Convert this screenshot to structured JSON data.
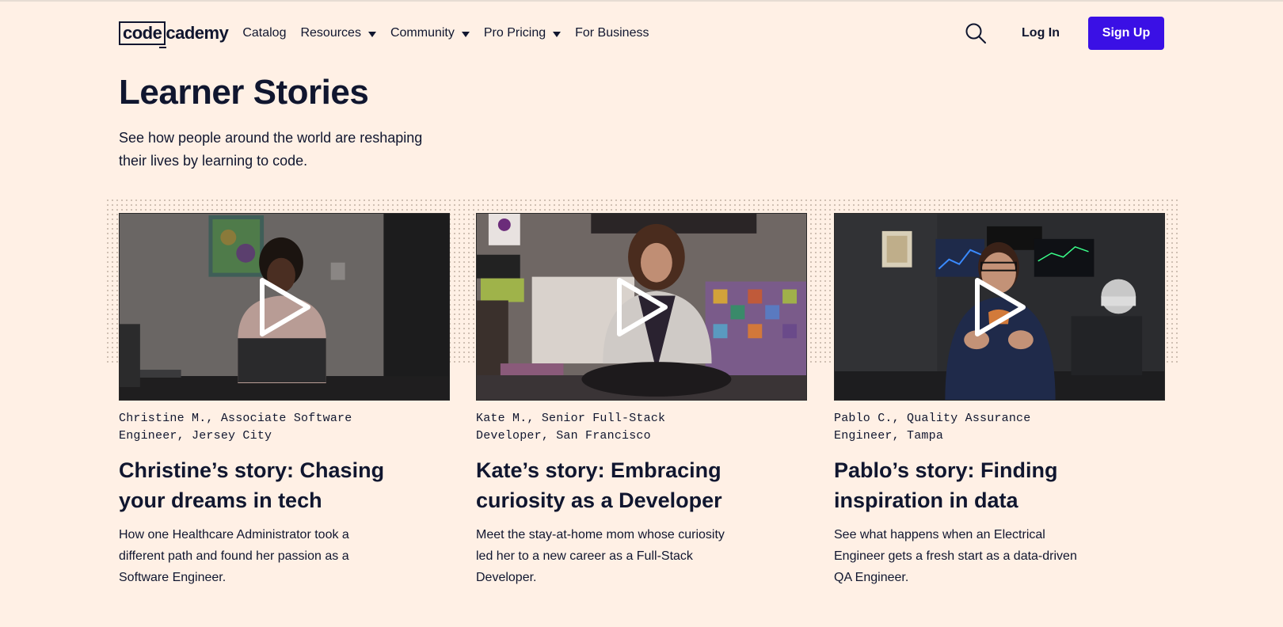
{
  "header": {
    "logo": {
      "boxed": "code",
      "rest": "cademy"
    },
    "nav": [
      {
        "label": "Catalog",
        "has_caret": false
      },
      {
        "label": "Resources",
        "has_caret": true
      },
      {
        "label": "Community",
        "has_caret": true
      },
      {
        "label": "Pro Pricing",
        "has_caret": true
      },
      {
        "label": "For Business",
        "has_caret": false
      }
    ],
    "search_icon": "search-icon",
    "login_label": "Log In",
    "signup_label": "Sign Up"
  },
  "hero": {
    "title": "Learner Stories",
    "subtitle": "See how people around the world are reshaping their lives by learning to code."
  },
  "stories": [
    {
      "byline": "Christine M., Associate Software Engineer, Jersey City",
      "title": "Christine’s story: Chasing your dreams in tech",
      "description": "How one Healthcare Administrator took a different path and found her passion as a Software Engineer."
    },
    {
      "byline": "Kate M., Senior Full-Stack Developer, San Francisco",
      "title": "Kate’s story: Embracing curiosity as a Developer",
      "description": "Meet the stay-at-home mom whose curiosity led her to a new career as a Full-Stack Developer."
    },
    {
      "byline": "Pablo C., Quality Assurance Engineer, Tampa",
      "title": "Pablo’s story: Finding inspiration in data",
      "description": "See what happens when an Electrical Engineer gets a fresh start as a data-driven QA Engineer."
    }
  ],
  "colors": {
    "background": "#fff0e5",
    "text": "#10162f",
    "signup_button": "#3a10e5"
  }
}
